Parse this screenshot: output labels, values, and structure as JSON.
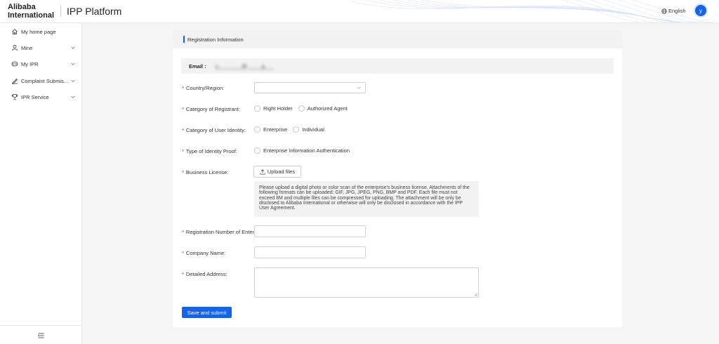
{
  "header": {
    "logo_line1": "Alibaba",
    "logo_line2": "International",
    "platform_title": "IPP Platform",
    "language": "English",
    "avatar_initial": "y"
  },
  "sidebar": {
    "items": [
      {
        "label": "My home page",
        "icon": "home-icon",
        "has_chevron": false
      },
      {
        "label": "Mine",
        "icon": "user-icon",
        "has_chevron": true
      },
      {
        "label": "My IPR",
        "icon": "shield-icon",
        "has_chevron": true
      },
      {
        "label": "Complaint Submis...",
        "icon": "megaphone-icon",
        "has_chevron": true
      },
      {
        "label": "IPR Service",
        "icon": "trophy-icon",
        "has_chevron": true
      }
    ],
    "collapse_icon": "menu-collapse-icon"
  },
  "form": {
    "section_title": "Registration Information",
    "email_label": "Email :",
    "email_value": "y________@_____g___",
    "country_label": "Country/Region:",
    "country_value": "",
    "registrant_label": "Category of Registrant:",
    "registrant_options": [
      "Right Holder",
      "Authorized Agent"
    ],
    "identity_label": "Category of User Identity:",
    "identity_options": [
      "Enterprise",
      "Individual"
    ],
    "proof_label": "Type of Identity Proof:",
    "proof_options": [
      "Enterprise Information Authentication"
    ],
    "license_label": "Business License:",
    "upload_label": "Upload files",
    "upload_hint": "Please upload a digital photo or color scan of the enterprise's business license. Attachments of the following formats can be uploaded: GIF, JPG, JPEG, PNG, BMP and PDF. Each file must not exceed 8M and multiple files can be compressed for uploading. The attachment will be only be disclosed to Alibaba International or otherwise will only be disclosed in accordance with the IPP User Agreement.",
    "reg_number_label": "Registration Number of Enter",
    "reg_number_value": "",
    "company_label": "Company Name:",
    "company_value": "",
    "address_label": "Detailed Address:",
    "address_value": "",
    "required_mark": "*",
    "submit_label": "Save and submit"
  },
  "colors": {
    "accent": "#1463e8",
    "required": "#e02020",
    "panel_bg": "#f2f2f2"
  }
}
